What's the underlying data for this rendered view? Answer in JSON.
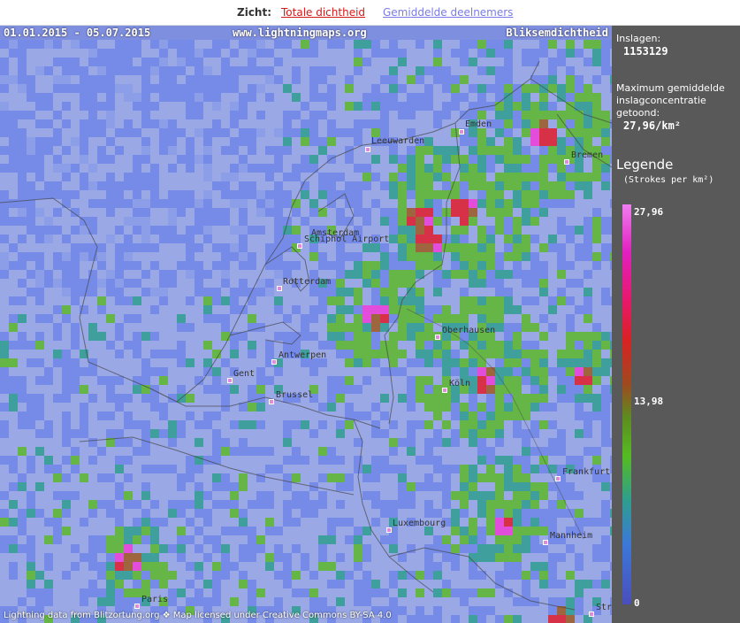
{
  "topbar": {
    "label": "Zicht:",
    "tabs": [
      {
        "label": "Totale dichtheid",
        "active": true
      },
      {
        "label": "Gemiddelde deelnemers",
        "active": false
      }
    ]
  },
  "map": {
    "date_range": "01.01.2015 - 05.07.2015",
    "site": "www.lightningmaps.org",
    "title": "Bliksemdichtheid",
    "attribution": "Lightning data from Blitzortung.org  ❖ Map licensed under Creative Commons BY-SA 4.0",
    "cities": [
      "Emden",
      "Leeuwarden",
      "Bremen",
      "Amsterdam",
      "Schiphol Airport",
      "Rotterdam",
      "Oberhausen",
      "Antwerpen",
      "Gent",
      "Brussel",
      "Köln",
      "Frankfurt",
      "Luxembourg",
      "Mannheim",
      "Paris",
      "Str"
    ]
  },
  "sidebar": {
    "strikes_label": "Inslagen:",
    "strikes_value": "1153129",
    "max_label_1": "Maximum gemiddelde",
    "max_label_2": "inslagconcentratie",
    "max_label_3": "getoond:",
    "max_value": "27,96/km²",
    "legend_title": "Legende",
    "legend_unit": "(Strokes per km²)",
    "legend_ticks": [
      "27,96",
      "13,98",
      "0"
    ]
  },
  "colors": {
    "base_blue": "#9aa8e6",
    "low": "#6f86e6",
    "teal": "#2f9e8e",
    "green": "#5cb82a",
    "brown": "#9e5a20",
    "red": "#e21c2c",
    "magenta": "#ee3ed8",
    "sidebar_bg": "#595959"
  }
}
